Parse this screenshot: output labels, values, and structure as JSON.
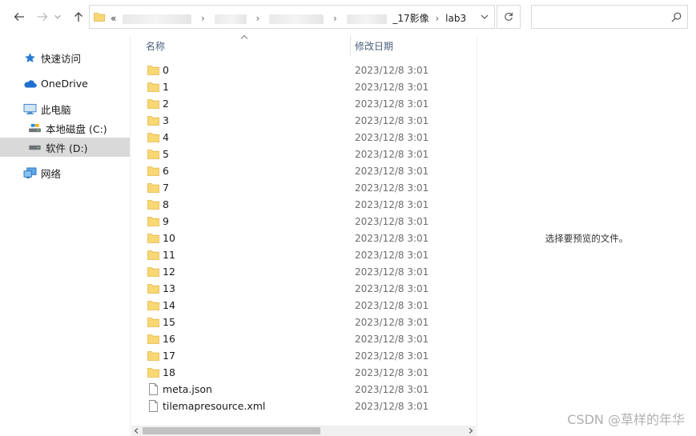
{
  "address": {
    "path_prefix": "«",
    "segments": [
      "",
      "",
      "",
      "_17影像",
      "lab3"
    ],
    "separator": "›"
  },
  "search": {
    "placeholder": ""
  },
  "nav": {
    "items": [
      {
        "label": "快速访问",
        "icon": "quick-access-star-icon"
      },
      {
        "label": "OneDrive",
        "icon": "onedrive-cloud-icon"
      },
      {
        "label": "此电脑",
        "icon": "this-pc-icon"
      },
      {
        "label": "本地磁盘 (C:)",
        "icon": "local-disk-c-icon"
      },
      {
        "label": "软件 (D:)",
        "icon": "drive-d-icon",
        "selected": true
      },
      {
        "label": "网络",
        "icon": "network-icon"
      }
    ]
  },
  "columns": {
    "name": "名称",
    "date": "修改日期"
  },
  "files": [
    {
      "name": "0",
      "type": "folder",
      "date": "2023/12/8 3:01"
    },
    {
      "name": "1",
      "type": "folder",
      "date": "2023/12/8 3:01"
    },
    {
      "name": "2",
      "type": "folder",
      "date": "2023/12/8 3:01"
    },
    {
      "name": "3",
      "type": "folder",
      "date": "2023/12/8 3:01"
    },
    {
      "name": "4",
      "type": "folder",
      "date": "2023/12/8 3:01"
    },
    {
      "name": "5",
      "type": "folder",
      "date": "2023/12/8 3:01"
    },
    {
      "name": "6",
      "type": "folder",
      "date": "2023/12/8 3:01"
    },
    {
      "name": "7",
      "type": "folder",
      "date": "2023/12/8 3:01"
    },
    {
      "name": "8",
      "type": "folder",
      "date": "2023/12/8 3:01"
    },
    {
      "name": "9",
      "type": "folder",
      "date": "2023/12/8 3:01"
    },
    {
      "name": "10",
      "type": "folder",
      "date": "2023/12/8 3:01"
    },
    {
      "name": "11",
      "type": "folder",
      "date": "2023/12/8 3:01"
    },
    {
      "name": "12",
      "type": "folder",
      "date": "2023/12/8 3:01"
    },
    {
      "name": "13",
      "type": "folder",
      "date": "2023/12/8 3:01"
    },
    {
      "name": "14",
      "type": "folder",
      "date": "2023/12/8 3:01"
    },
    {
      "name": "15",
      "type": "folder",
      "date": "2023/12/8 3:01"
    },
    {
      "name": "16",
      "type": "folder",
      "date": "2023/12/8 3:01"
    },
    {
      "name": "17",
      "type": "folder",
      "date": "2023/12/8 3:01"
    },
    {
      "name": "18",
      "type": "folder",
      "date": "2023/12/8 3:01"
    },
    {
      "name": "meta.json",
      "type": "file",
      "date": "2023/12/8 3:01"
    },
    {
      "name": "tilemapresource.xml",
      "type": "file",
      "date": "2023/12/8 3:01"
    }
  ],
  "preview": {
    "message": "选择要预览的文件。"
  },
  "watermark": "CSDN @草样的年华",
  "colors": {
    "folder": "#f8d775",
    "folder_dark": "#e8b84a",
    "selected_nav": "#d9d9d9",
    "header_text": "#4c607a"
  }
}
